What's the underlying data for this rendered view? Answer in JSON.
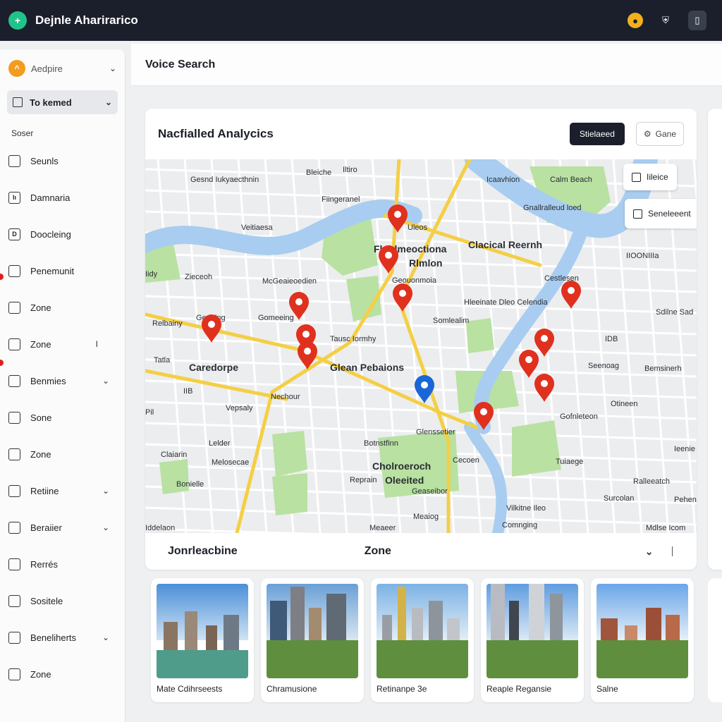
{
  "app": {
    "title": "Dejnle Aharirarico"
  },
  "sidebar": {
    "top_label": "Aedpire",
    "select_label": "To kemed",
    "section_label": "Soser",
    "items": [
      {
        "label": "Seunls",
        "glyph": "",
        "chevron": false
      },
      {
        "label": "Damnaria",
        "glyph": "lı",
        "chevron": false
      },
      {
        "label": "Doocleing",
        "glyph": "D",
        "chevron": false
      },
      {
        "label": "Penemunit",
        "glyph": "",
        "chevron": false
      },
      {
        "label": "Zone",
        "glyph": "",
        "chevron": false
      },
      {
        "label": "Zone",
        "glyph": "",
        "chevron": false,
        "trailing": "I"
      },
      {
        "label": "Benmies",
        "glyph": "",
        "chevron": true
      },
      {
        "label": "Sone",
        "glyph": "",
        "chevron": false
      },
      {
        "label": "Zone",
        "glyph": "",
        "chevron": false
      },
      {
        "label": "Retiine",
        "glyph": "",
        "chevron": true
      },
      {
        "label": "Beraiier",
        "glyph": "",
        "chevron": true
      },
      {
        "label": "Rerrés",
        "glyph": "",
        "chevron": false
      },
      {
        "label": "Sositele",
        "glyph": "",
        "chevron": false
      },
      {
        "label": "Beneliherts",
        "glyph": "",
        "chevron": true
      },
      {
        "label": "Zone",
        "glyph": "",
        "chevron": false
      }
    ]
  },
  "header": {
    "title": "Voice Search"
  },
  "card": {
    "title": "Nacfialled Analycics",
    "primary_button": "Stielaeed",
    "secondary_button": "Gane",
    "map_controls": [
      "Iileice",
      "Seneleeent"
    ],
    "footer_left": "Jonrleacbine",
    "footer_zone": "Zone"
  },
  "map": {
    "labels": [
      {
        "text": "Gesnd Iukyaecthnin",
        "bold": false
      },
      {
        "text": "Bleiche",
        "bold": false
      },
      {
        "text": "Iltiro",
        "bold": false
      },
      {
        "text": "Icaavhion",
        "bold": false
      },
      {
        "text": "Calm Beach",
        "bold": false
      },
      {
        "text": "Gnallralleud loed",
        "bold": false
      },
      {
        "text": "Fiingeranel",
        "bold": false
      },
      {
        "text": "Veitiaesa",
        "bold": false
      },
      {
        "text": "Uleos",
        "bold": false
      },
      {
        "text": "Clacical Reernh",
        "bold": true
      },
      {
        "text": "Flohlmeoctiona",
        "bold": true
      },
      {
        "text": "Rlmlon",
        "bold": true
      },
      {
        "text": "IIOONIIIa",
        "bold": false
      },
      {
        "text": "Iidy",
        "bold": false
      },
      {
        "text": "Zieceoh",
        "bold": false
      },
      {
        "text": "McGeaieoedien",
        "bold": false
      },
      {
        "text": "Geouonmoia",
        "bold": false
      },
      {
        "text": "Cestlesen",
        "bold": false
      },
      {
        "text": "Geonlng",
        "bold": false
      },
      {
        "text": "Hleeinate Dleo Celendia",
        "bold": false
      },
      {
        "text": "Sdilne Sad",
        "bold": false
      },
      {
        "text": "Relbainy",
        "bold": false
      },
      {
        "text": "Gomeeing",
        "bold": false
      },
      {
        "text": "Somlealim",
        "bold": false
      },
      {
        "text": "Tausc Iormhy",
        "bold": false
      },
      {
        "text": "IDB",
        "bold": false
      },
      {
        "text": "Tatla",
        "bold": false
      },
      {
        "text": "Caredorpe",
        "bold": true
      },
      {
        "text": "Glean Pebaions",
        "bold": true
      },
      {
        "text": "Seenoag",
        "bold": false
      },
      {
        "text": "Bemsinerh",
        "bold": false
      },
      {
        "text": "IIB",
        "bold": false
      },
      {
        "text": "Nechour",
        "bold": false
      },
      {
        "text": "Vepsaly",
        "bold": false
      },
      {
        "text": "Otineen",
        "bold": false
      },
      {
        "text": "Pil",
        "bold": false
      },
      {
        "text": "Gofnleteon",
        "bold": false
      },
      {
        "text": "Glenssetier",
        "bold": false
      },
      {
        "text": "Lelder",
        "bold": false
      },
      {
        "text": "Botnstfinn",
        "bold": false
      },
      {
        "text": "Ieenie",
        "bold": false
      },
      {
        "text": "Claiarin",
        "bold": false
      },
      {
        "text": "Melosecae",
        "bold": false
      },
      {
        "text": "Cecoen",
        "bold": false
      },
      {
        "text": "Tuiaege",
        "bold": false
      },
      {
        "text": "Cholroeroch",
        "bold": true
      },
      {
        "text": "Reprain",
        "bold": false
      },
      {
        "text": "Oleeited",
        "bold": true
      },
      {
        "text": "Ralleeatch",
        "bold": false
      },
      {
        "text": "Bonielle",
        "bold": false
      },
      {
        "text": "Geaseibor",
        "bold": false
      },
      {
        "text": "Surcolan",
        "bold": false
      },
      {
        "text": "Pehen",
        "bold": false
      },
      {
        "text": "Vilkitne Ileo",
        "bold": false
      },
      {
        "text": "Meaiog",
        "bold": false
      },
      {
        "text": "Comnging",
        "bold": false
      },
      {
        "text": "Iddelaon",
        "bold": false
      },
      {
        "text": "Meaeer",
        "bold": false
      },
      {
        "text": "Mdlse Icom",
        "bold": false
      }
    ]
  },
  "colors": {
    "topbar": "#1b1f2b",
    "accent_green": "#21c38b",
    "pin_red": "#e0301e",
    "pin_blue": "#1a66d6",
    "road_yellow": "#f4cf45",
    "water": "#a8cdf0",
    "park": "#b9e1a2"
  },
  "icons": {
    "logo": "app-logo-icon",
    "notifications": "bell-badge-icon",
    "shield": "shield-icon",
    "device": "device-icon"
  },
  "thumbnails": [
    {
      "caption": "Mate Cdihrseests"
    },
    {
      "caption": "Chramusione"
    },
    {
      "caption": "Retinanpe 3e"
    },
    {
      "caption": "Reaple Regansie"
    },
    {
      "caption": "Salne"
    }
  ]
}
